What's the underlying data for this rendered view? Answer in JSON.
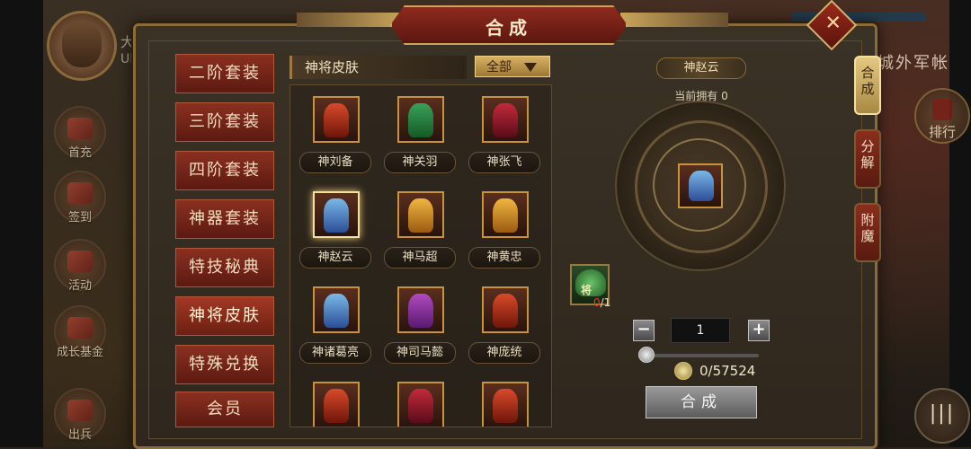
{
  "hud": {
    "player_name": "大将",
    "player_uid": "UID",
    "left_menu": [
      {
        "label": "首充"
      },
      {
        "label": "签到"
      },
      {
        "label": "活动"
      },
      {
        "label": "成长基金"
      },
      {
        "label": "出兵"
      }
    ],
    "right_title": "城外军帐",
    "rank_label": "排行",
    "rank_icon_char": "特",
    "menu_label": "|||"
  },
  "panel": {
    "title": "合成",
    "close_label": "✕"
  },
  "categories": [
    {
      "label": "二阶套装",
      "active": false
    },
    {
      "label": "三阶套装",
      "active": false
    },
    {
      "label": "四阶套装",
      "active": false
    },
    {
      "label": "神器套装",
      "active": false
    },
    {
      "label": "特技秘典",
      "active": false
    },
    {
      "label": "神将皮肤",
      "active": true
    },
    {
      "label": "特殊兑换",
      "active": false
    },
    {
      "label": "会员",
      "active": false
    }
  ],
  "grid": {
    "heading": "神将皮肤",
    "filter_value": "全部",
    "items": [
      {
        "name": "神刘备",
        "color": "red",
        "selected": false
      },
      {
        "name": "神关羽",
        "color": "green",
        "selected": false
      },
      {
        "name": "神张飞",
        "color": "crimson",
        "selected": false
      },
      {
        "name": "神赵云",
        "color": "blue",
        "selected": true
      },
      {
        "name": "神马超",
        "color": "gold",
        "selected": false
      },
      {
        "name": "神黄忠",
        "color": "gold",
        "selected": false
      },
      {
        "name": "神诸葛亮",
        "color": "blue",
        "selected": false
      },
      {
        "name": "神司马懿",
        "color": "purple",
        "selected": false
      },
      {
        "name": "神庞统",
        "color": "red",
        "selected": false
      },
      {
        "name": "",
        "color": "red",
        "selected": false
      },
      {
        "name": "",
        "color": "crimson",
        "selected": false
      },
      {
        "name": "",
        "color": "red",
        "selected": false
      }
    ]
  },
  "detail": {
    "hero_name": "神赵云",
    "owned_text": "当前拥有 0",
    "material_char": "将",
    "material_have": "0",
    "material_need": "/1",
    "quantity": "1",
    "minus_label": "−",
    "plus_label": "+",
    "slider_value": 0,
    "coin_text": "0/57524",
    "compose_label": "合成"
  },
  "side_tabs": [
    {
      "label": "合成",
      "active": true
    },
    {
      "label": "分解",
      "active": false
    },
    {
      "label": "附魔",
      "active": false
    }
  ]
}
